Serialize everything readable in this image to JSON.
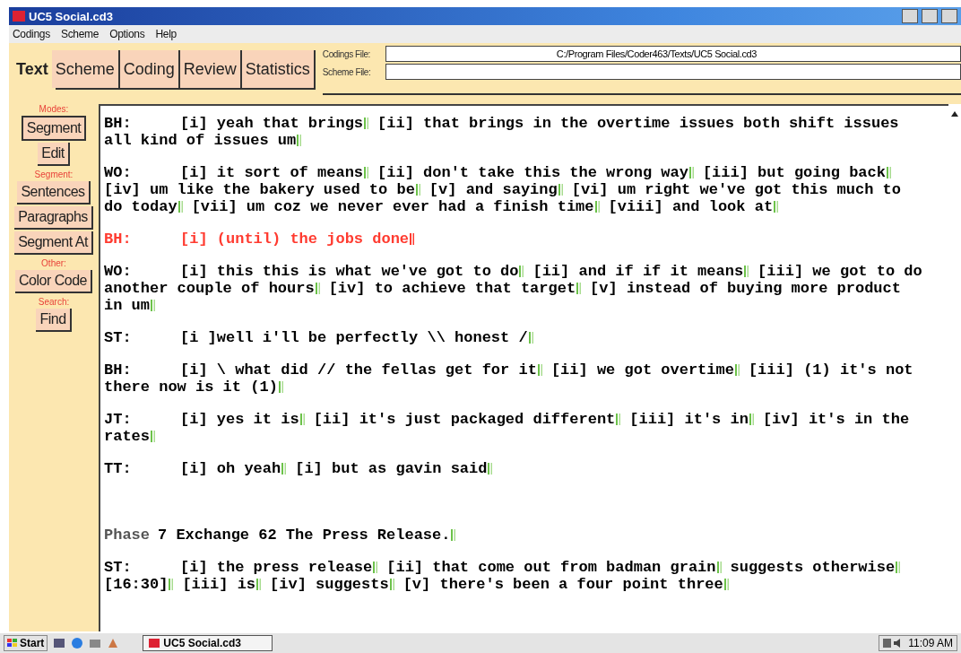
{
  "window": {
    "title": "UC5 Social.cd3"
  },
  "menu": [
    "Codings",
    "Scheme",
    "Options",
    "Help"
  ],
  "tabs": [
    {
      "label": "Text",
      "selected": true
    },
    {
      "label": "Scheme",
      "selected": false
    },
    {
      "label": "Coding",
      "selected": false
    },
    {
      "label": "Review",
      "selected": false
    },
    {
      "label": "Statistics",
      "selected": false
    }
  ],
  "files": [
    {
      "label": "Codings File:",
      "value": "C:/Program Files/Coder463/Texts/UC5 Social.cd3"
    },
    {
      "label": "Scheme File:"
    }
  ],
  "sidebar": [
    {
      "heading": "Modes:",
      "buttons": [
        {
          "label": "Segment",
          "selected": true
        },
        {
          "label": "Edit",
          "selected": false
        }
      ]
    },
    {
      "heading": "Segment:",
      "buttons": [
        {
          "label": "Sentences",
          "selected": false
        },
        {
          "label": "Paragraphs",
          "selected": false
        },
        {
          "label": "Segment At",
          "selected": false
        }
      ]
    },
    {
      "heading": "Other:",
      "buttons": [
        {
          "label": "Color Code",
          "selected": false
        }
      ]
    },
    {
      "heading": "Search:",
      "buttons": [
        {
          "label": "Find",
          "selected": false
        }
      ]
    }
  ],
  "transcript": [
    {
      "kind": "speech",
      "speaker": "BH:",
      "color": "#000000",
      "lines": [
        [
          {
            "text": "[i] yeah that brings",
            "end": true
          },
          {
            "text": "[ii] that brings in the overtime issues both shift issues",
            "end": false
          }
        ],
        [
          {
            "text": "all kind of issues um",
            "end": true
          }
        ]
      ]
    },
    {
      "kind": "speech",
      "speaker": "WO:",
      "color": "#000000",
      "lines": [
        [
          {
            "text": "[i] it sort of means",
            "end": true
          },
          {
            "text": "[ii] don't take this the wrong way",
            "end": true
          },
          {
            "text": "[iii] but going back",
            "end": true
          }
        ],
        [
          {
            "text": "[iv] um like the bakery used to be",
            "end": true
          },
          {
            "text": "[v] and saying",
            "end": true
          },
          {
            "text": "[vi] um right we've got this much to",
            "end": false
          }
        ],
        [
          {
            "text": "do today",
            "end": true
          },
          {
            "text": "[vii] um coz we never ever had a finish time",
            "end": true
          },
          {
            "text": "[viii] and look at",
            "end": true
          }
        ]
      ]
    },
    {
      "kind": "speech",
      "speaker": "BH:",
      "color": "#ff3b30",
      "lines": [
        [
          {
            "text": "[i] (until) the jobs done",
            "end": true
          }
        ]
      ]
    },
    {
      "kind": "speech",
      "speaker": "WO:",
      "color": "#000000",
      "lines": [
        [
          {
            "text": "[i] this this is what we've got to do",
            "end": true
          },
          {
            "text": "[ii] and if if it means",
            "end": true
          },
          {
            "text": "[iii] we got to do",
            "end": false
          }
        ],
        [
          {
            "text": "another couple of hours",
            "end": true
          },
          {
            "text": "[iv] to achieve that target",
            "end": true
          },
          {
            "text": "[v] instead of buying more product",
            "end": false
          }
        ],
        [
          {
            "text": "in um",
            "end": true
          }
        ]
      ]
    },
    {
      "kind": "speech",
      "speaker": "ST:",
      "color": "#000000",
      "lines": [
        [
          {
            "text": "[i ]well i'll be perfectly \\\\ honest /",
            "end": true
          }
        ]
      ]
    },
    {
      "kind": "speech",
      "speaker": "BH:",
      "color": "#000000",
      "lines": [
        [
          {
            "text": "[i] \\ what did // the fellas get for it",
            "end": true
          },
          {
            "text": "[ii] we got overtime",
            "end": true
          },
          {
            "text": "[iii] (1) it's not",
            "end": false
          }
        ],
        [
          {
            "text": "there now is it (1)",
            "end": true
          }
        ]
      ]
    },
    {
      "kind": "speech",
      "speaker": "JT:",
      "color": "#000000",
      "lines": [
        [
          {
            "text": "[i] yes it is",
            "end": true
          },
          {
            "text": "[ii] it's just packaged different",
            "end": true
          },
          {
            "text": "[iii] it's in",
            "end": true
          },
          {
            "text": "[iv] it's in the",
            "end": false
          }
        ],
        [
          {
            "text": "rates",
            "end": true
          }
        ]
      ]
    },
    {
      "kind": "speech",
      "speaker": "TT:",
      "color": "#000000",
      "lines": [
        [
          {
            "text": "[i] oh yeah",
            "end": true
          },
          {
            "text": "[i] but as gavin said",
            "end": true
          }
        ]
      ]
    },
    {
      "kind": "heading",
      "speaker": "Phase",
      "color": "#000000",
      "lines": [
        [
          {
            "text": "7 Exchange 62 The Press Release.",
            "end": true
          }
        ]
      ]
    },
    {
      "kind": "speech",
      "speaker": "ST:",
      "color": "#000000",
      "lines": [
        [
          {
            "text": "[i] the press release",
            "end": true
          },
          {
            "text": "[ii] that come out from badman grain",
            "end": true
          },
          {
            "text": "suggests otherwise",
            "end": true
          }
        ],
        [
          {
            "text": "[16:30]",
            "end": true
          },
          {
            "text": "[iii] is",
            "end": true
          },
          {
            "text": "[iv] suggests",
            "end": true
          },
          {
            "text": "[v] there's been a four point three",
            "end": true
          }
        ]
      ]
    }
  ],
  "taskbar": {
    "start": "Start",
    "task": "UC5 Social.cd3",
    "clock": "11:09 AM"
  }
}
